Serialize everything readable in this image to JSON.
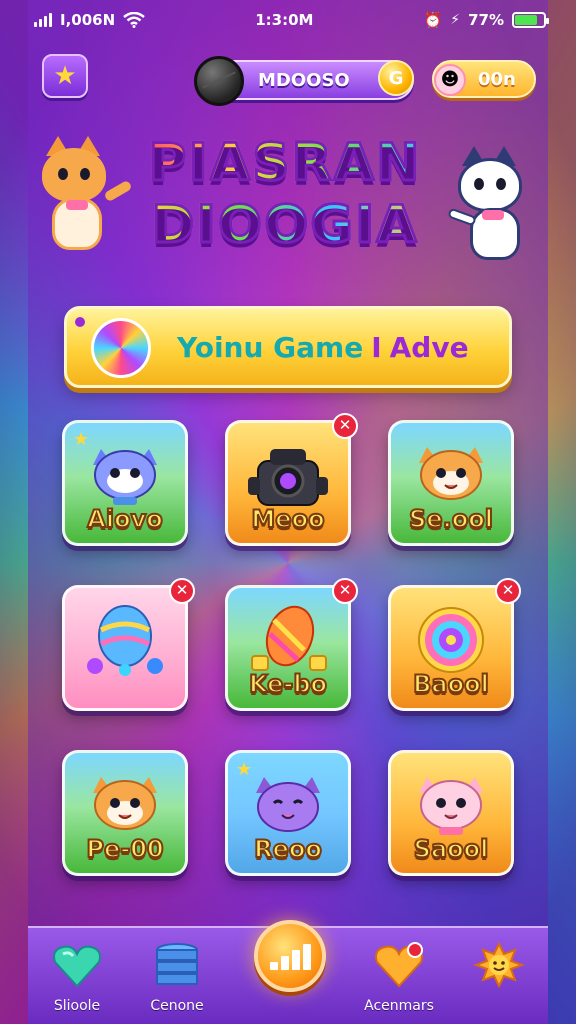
{
  "status_bar": {
    "carrier": "I,006N",
    "time": "1:3:0M",
    "battery": "77%",
    "battery_level": 0.77
  },
  "header": {
    "player_name": "MDOOSO",
    "coin_symbol": "G",
    "gold_value": "00n"
  },
  "title": {
    "line1": "PIASRAN",
    "line2": "DIOOGIA"
  },
  "banner": {
    "text": "Yoinu Game",
    "separator": "I",
    "suffix": "Adve"
  },
  "levels": [
    {
      "label": "Aiovo",
      "theme": "green",
      "art": "cat-blue",
      "closable": false,
      "star": true
    },
    {
      "label": "Meoo",
      "theme": "orange",
      "art": "robot",
      "closable": true,
      "star": false
    },
    {
      "label": "Se.ool",
      "theme": "green",
      "art": "cat-orange",
      "closable": false,
      "star": false
    },
    {
      "label": "",
      "theme": "pink",
      "art": "egg",
      "closable": true,
      "star": false
    },
    {
      "label": "Ke-bo",
      "theme": "green",
      "art": "candy-gem",
      "closable": true,
      "star": false
    },
    {
      "label": "Baool",
      "theme": "orange",
      "art": "lollipop",
      "closable": true,
      "star": false
    },
    {
      "label": "Pe-00",
      "theme": "green",
      "art": "cat-orange",
      "closable": false,
      "star": false
    },
    {
      "label": "Reoo",
      "theme": "blue",
      "art": "cat-purple",
      "closable": false,
      "star": true
    },
    {
      "label": "Saool",
      "theme": "orange",
      "art": "cat-pink",
      "closable": false,
      "star": false
    }
  ],
  "nav": {
    "items": [
      {
        "label": "Slioole",
        "icon": "heart-gem-icon"
      },
      {
        "label": "Cenone",
        "icon": "stack-icon"
      },
      {
        "label": "",
        "icon": "chart-icon"
      },
      {
        "label": "Acenmars",
        "icon": "heart-icon"
      },
      {
        "label": "",
        "icon": "sun-star-icon"
      }
    ]
  },
  "colors": {
    "accent_purple": "#8a3fe0",
    "banner_gold": "#ffd23a",
    "close_red": "#e8253b",
    "label_yellow": "#ffe76a"
  }
}
